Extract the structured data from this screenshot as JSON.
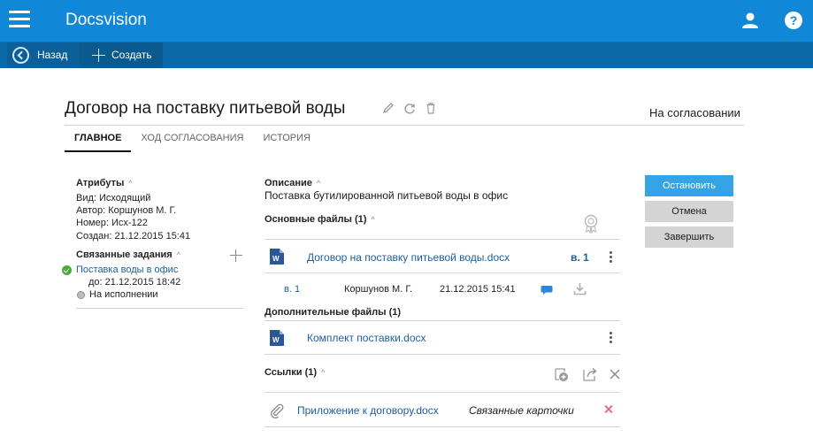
{
  "header": {
    "app_title": "Docsvision"
  },
  "toolbar": {
    "back_label": "Назад",
    "create_label": "Создать"
  },
  "document": {
    "title": "Договор на поставку питьевой воды",
    "status": "На согласовании",
    "tabs": [
      {
        "label": "Главное"
      },
      {
        "label": "Ход согласования"
      },
      {
        "label": "История"
      }
    ]
  },
  "attributes": {
    "heading": "Атрибуты",
    "lines": [
      "Вид: Исходящий",
      "Автор: Коршунов М. Г.",
      "Номер: Исх-122",
      "Создан:  21.12.2015 15:41"
    ]
  },
  "related_tasks": {
    "heading": "Связанные задания",
    "task_title": "Поставка воды в офис",
    "task_due": "до: 21.12.2015 18:42",
    "task_state": "На исполнении"
  },
  "description": {
    "heading": "Описание",
    "text": "Поставка бутилированной питьевой воды в офис"
  },
  "main_files": {
    "heading": "Основные файлы (1)",
    "file_name": "Договор на поставку питьевой воды.docx",
    "file_version": "в. 1",
    "version_row": {
      "version": "в. 1",
      "author": "Коршунов М. Г.",
      "date": "21.12.2015 15:41"
    }
  },
  "additional_files": {
    "heading": "Дополнительные файлы (1)",
    "file_name": "Комплект поставки.docx"
  },
  "links": {
    "heading": "Ссылки (1)",
    "item_name": "Приложение к договору.docx",
    "item_type": "Связанные карточки"
  },
  "actions": {
    "stop": "Остановить",
    "cancel": "Отмена",
    "finish": "Завершить"
  },
  "colors": {
    "header": "#1187d8",
    "toolbar": "#0c6aa8",
    "primary_button": "#34a4e6",
    "link": "#1a5f9e"
  }
}
